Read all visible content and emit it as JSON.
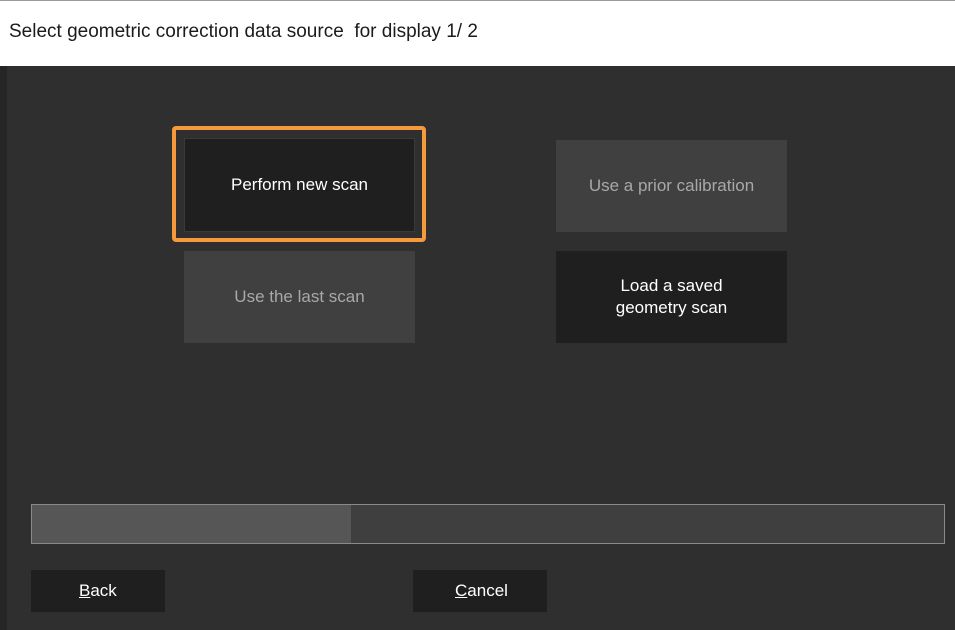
{
  "window": {
    "title": "Select geometric correction data source  for display 1/ 2"
  },
  "options": {
    "perform_new_scan": {
      "label": "Perform new scan",
      "enabled": true,
      "focused": true
    },
    "use_prior_calibration": {
      "label": "Use a prior calibration",
      "enabled": false
    },
    "use_last_scan": {
      "label": "Use the last scan",
      "enabled": false
    },
    "load_saved_scan": {
      "label": "Load a saved\ngeometry scan",
      "enabled": true
    }
  },
  "progress": {
    "fraction": 0.35
  },
  "footer": {
    "back": {
      "mnemonic": "B",
      "rest": "ack"
    },
    "cancel": {
      "mnemonic": "C",
      "rest": "ancel"
    }
  },
  "colors": {
    "background": "#2f2f2f",
    "focus_accent": "#f59a3c",
    "button_dark": "#1f1f1f",
    "button_disabled": "#404040",
    "disabled_text": "#a8a8a8"
  }
}
